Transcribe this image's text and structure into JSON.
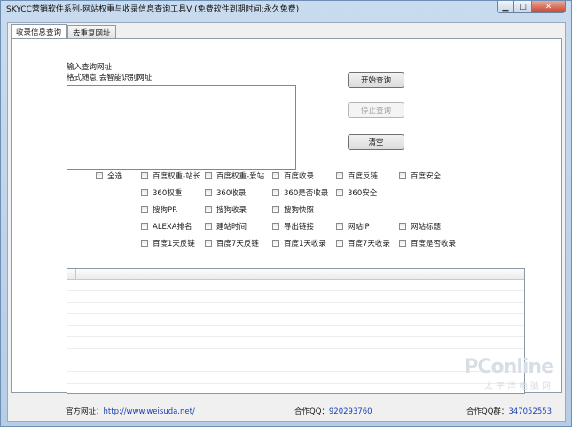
{
  "window": {
    "title": "SKYCC营销软件系列-网站权重与收录信息查询工具V (免费软件到期时间:永久免费)",
    "min_glyph": "▁",
    "max_glyph": "□",
    "close_glyph": "✕"
  },
  "tabs": [
    {
      "label": "收录信息查询",
      "active": true
    },
    {
      "label": "去重复网址",
      "active": false
    }
  ],
  "query": {
    "input_label": "输入查询网址",
    "format_hint": "格式随意,会智能识别网址",
    "url_value": ""
  },
  "buttons": {
    "start": "开始查询",
    "stop": "停止查询",
    "clear": "清空"
  },
  "options": {
    "select_all": "全选",
    "rows": [
      [
        "百度权重-站长",
        "百度权重-爱站",
        "百度收录",
        "百度反链",
        "百度安全"
      ],
      [
        "360权重",
        "360收录",
        "360是否收录",
        "360安全"
      ],
      [
        "搜狗PR",
        "搜狗收录",
        "搜狗快照"
      ],
      [
        "ALEXA排名",
        "建站时间",
        "导出链接",
        "网站IP",
        "网站标题"
      ],
      [
        "百度1天反链",
        "百度7天反链",
        "百度1天收录",
        "百度7天收录",
        "百度是否收录"
      ]
    ]
  },
  "footer": {
    "site_label": "官方网址：",
    "site_url": "http://www.weisuda.net/",
    "qq_label": "合作QQ：",
    "qq_value": "920293760",
    "group_label": "合作QQ群：",
    "group_value": "347052553"
  },
  "watermark": {
    "logo": "PConline",
    "sub": "太平洋电脑网"
  }
}
